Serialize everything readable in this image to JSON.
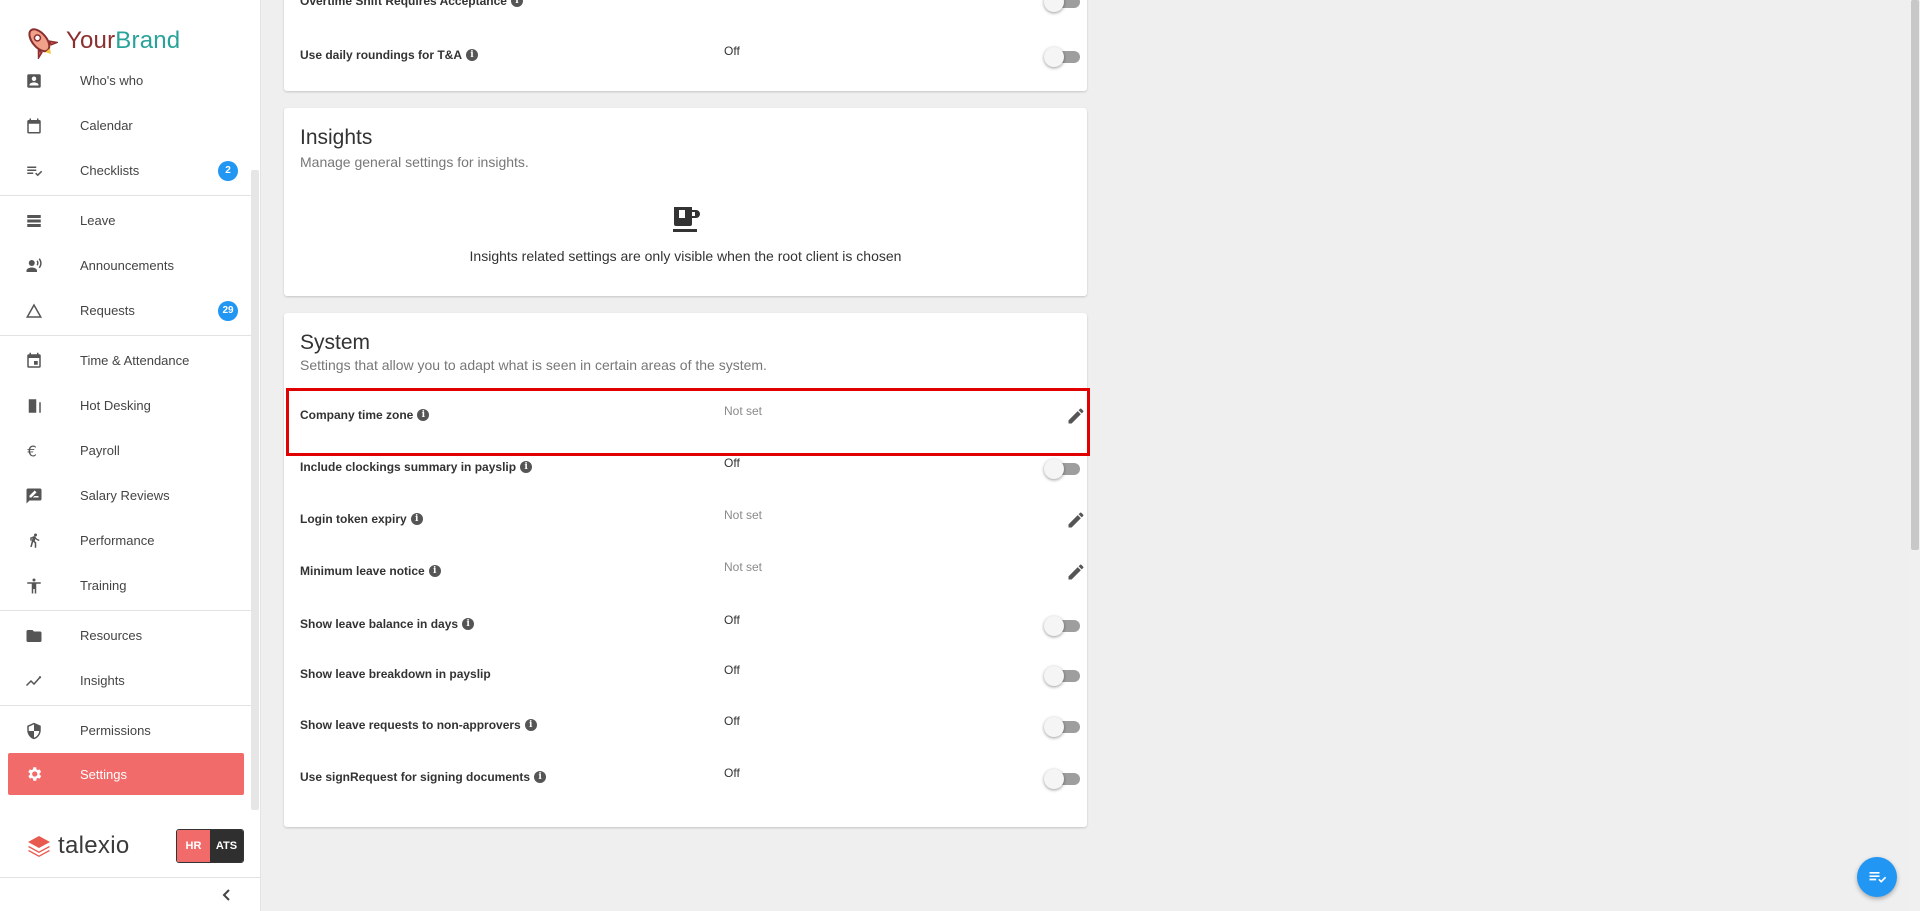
{
  "brand": {
    "name_part1": "Your",
    "name_part2": "Brand"
  },
  "sidebar": {
    "items": [
      {
        "label": "Who's who",
        "icon": "contact-icon"
      },
      {
        "label": "Calendar",
        "icon": "calendar-icon"
      },
      {
        "label": "Checklists",
        "icon": "checklist-icon",
        "count": "2"
      },
      {
        "label": "Leave",
        "icon": "leave-icon"
      },
      {
        "label": "Announcements",
        "icon": "announcement-icon"
      },
      {
        "label": "Requests",
        "icon": "requests-icon",
        "count": "29"
      },
      {
        "label": "Time & Attendance",
        "icon": "event-icon"
      },
      {
        "label": "Hot Desking",
        "icon": "door-icon"
      },
      {
        "label": "Payroll",
        "icon": "euro-icon"
      },
      {
        "label": "Salary Reviews",
        "icon": "rate-review-icon"
      },
      {
        "label": "Performance",
        "icon": "running-icon"
      },
      {
        "label": "Training",
        "icon": "accessibility-icon"
      },
      {
        "label": "Resources",
        "icon": "folder-icon"
      },
      {
        "label": "Insights",
        "icon": "trending-icon"
      },
      {
        "label": "Permissions",
        "icon": "shield-icon"
      },
      {
        "label": "Settings",
        "icon": "gear-icon",
        "active": true
      }
    ],
    "footer": {
      "logo_text": "talexio",
      "hr_label": "HR",
      "ats_label": "ATS"
    }
  },
  "top_card": {
    "rows": [
      {
        "label": "Overtime Shift Requires Acceptance",
        "value": "",
        "control": "toggle"
      },
      {
        "label": "Use daily roundings for T&A",
        "value": "Off",
        "control": "toggle"
      }
    ]
  },
  "insights": {
    "title": "Insights",
    "subtitle": "Manage general settings for insights.",
    "note": "Insights related settings are only visible when the root client is chosen"
  },
  "system": {
    "title": "System",
    "subtitle": "Settings that allow you to adapt what is seen in certain areas of the system.",
    "rows": [
      {
        "label": "Company time zone",
        "info": true,
        "value": "Not set",
        "control": "edit"
      },
      {
        "label": "Include clockings summary in payslip",
        "info": true,
        "value": "Off",
        "control": "toggle"
      },
      {
        "label": "Login token expiry",
        "info": true,
        "value": "Not set",
        "control": "edit"
      },
      {
        "label": "Minimum leave notice",
        "info": true,
        "value": "Not set",
        "control": "edit"
      },
      {
        "label": "Show leave balance in days",
        "info": true,
        "value": "Off",
        "control": "toggle"
      },
      {
        "label": "Show leave breakdown in payslip",
        "info": false,
        "value": "Off",
        "control": "toggle"
      },
      {
        "label": "Show leave requests to non-approvers",
        "info": true,
        "value": "Off",
        "control": "toggle"
      },
      {
        "label": "Use signRequest for signing documents",
        "info": true,
        "value": "Off",
        "control": "toggle"
      }
    ]
  },
  "colors": {
    "accent": "#f26b6b",
    "badge": "#2196f3",
    "highlight": "#e00000"
  }
}
